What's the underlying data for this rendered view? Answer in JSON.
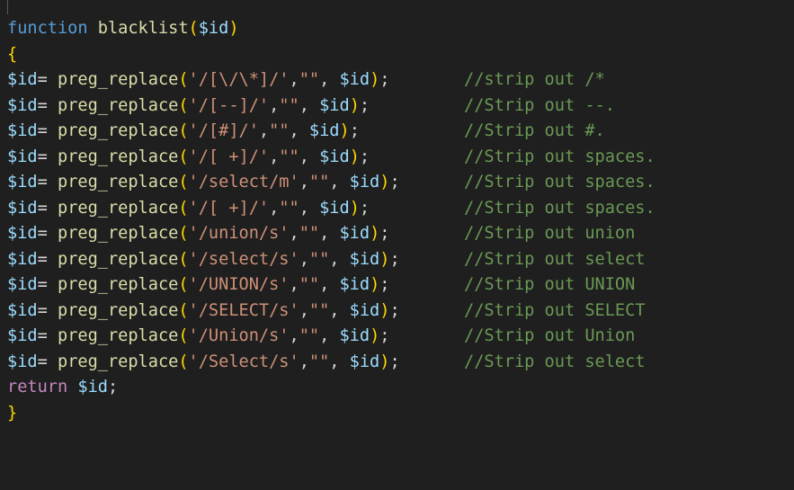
{
  "code": {
    "header": {
      "keyword": "function",
      "name": "blacklist",
      "open_paren": "(",
      "param": "$id",
      "close_paren": ")"
    },
    "open_brace": "{",
    "assign_lhs": "$id",
    "assign_op": "=",
    "func_name": "preg_replace",
    "empty_string": "\"\"",
    "var_name": "$id",
    "statements": [
      {
        "pattern": "'/[\\/\\*]/'",
        "comment": "//strip out /*"
      },
      {
        "pattern": "'/[--]/'",
        "comment": "//Strip out --."
      },
      {
        "pattern": "'/[#]/'",
        "comment": "//Strip out #."
      },
      {
        "pattern": "'/[ +]/'",
        "comment": "//Strip out spaces."
      },
      {
        "pattern": "'/select/m'",
        "comment": "//Strip out spaces."
      },
      {
        "pattern": "'/[ +]/'",
        "comment": "//Strip out spaces."
      },
      {
        "pattern": "'/union/s'",
        "comment": "//Strip out union"
      },
      {
        "pattern": "'/select/s'",
        "comment": "//Strip out select"
      },
      {
        "pattern": "'/UNION/s'",
        "comment": "//Strip out UNION"
      },
      {
        "pattern": "'/SELECT/s'",
        "comment": "//Strip out SELECT"
      },
      {
        "pattern": "'/Union/s'",
        "comment": "//Strip out Union"
      },
      {
        "pattern": "'/Select/s'",
        "comment": "//Strip out select"
      }
    ],
    "return_keyword": "return",
    "return_value": "$id",
    "close_brace": "}",
    "colors": {
      "background": "#1f1f1f",
      "keyword": "#569cd6",
      "control_keyword": "#c586c0",
      "function": "#dcdcaa",
      "variable": "#9cdcfe",
      "string": "#ce9178",
      "comment": "#6a9955",
      "punctuation": "#d4d4d4",
      "bracket": "#ffd700"
    }
  }
}
